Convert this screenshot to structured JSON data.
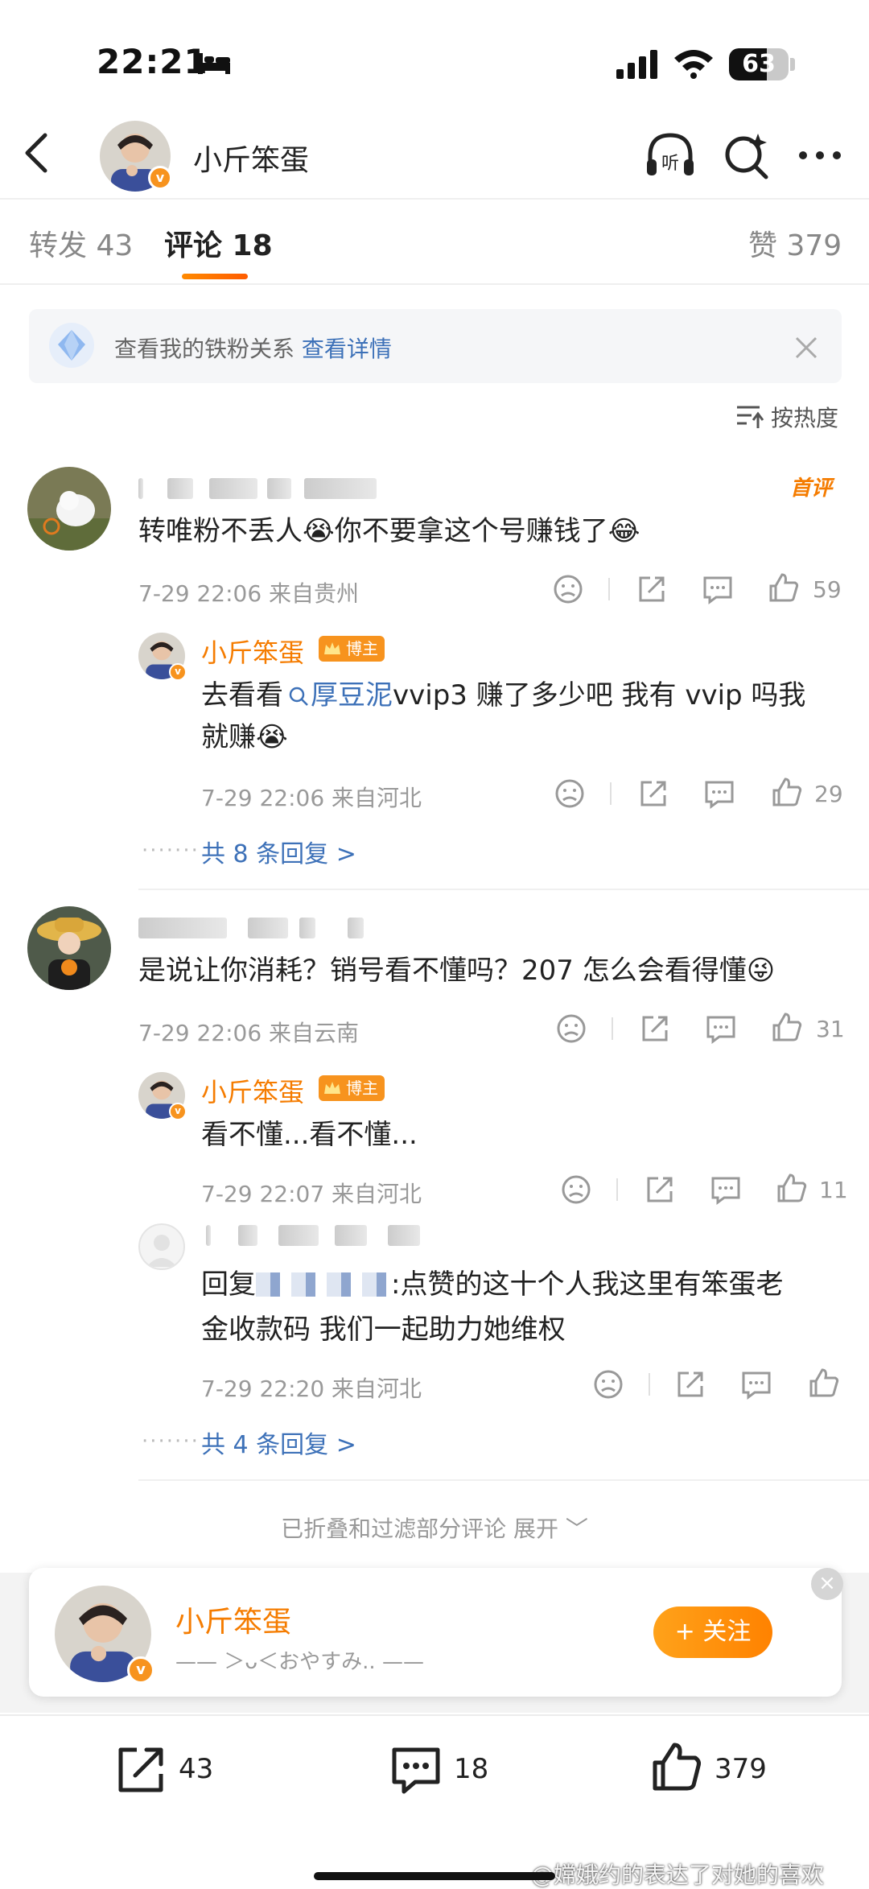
{
  "status_bar": {
    "time": "22:21",
    "battery": "63",
    "battery_level": 0.63
  },
  "nav": {
    "title": "小斤笨蛋"
  },
  "tabs": [
    {
      "label": "转发 43"
    },
    {
      "label": "评论 18"
    },
    {
      "label": "赞 379"
    }
  ],
  "fan_banner": {
    "text": "查看我的铁粉关系",
    "link": "查看详情"
  },
  "sort": {
    "label": "按热度"
  },
  "comments": [
    {
      "badge": "首评",
      "text": "转唯粉不丢人😭你不要拿这个号赚钱了😂",
      "meta": "7-29 22:06 来自贵州",
      "likes": "59",
      "reply": {
        "name": "小斤笨蛋",
        "tag": "博主",
        "text_prefix": "去看看",
        "link": "厚豆泥",
        "text_line1_rest": "vvip3 赚了多少吧 我有 vvip 吗我",
        "text_line2": "就赚😭",
        "meta": "7-29 22:06 来自河北",
        "likes": "29"
      },
      "more": "共 8 条回复 >"
    },
    {
      "text": "是说让你消耗？销号看不懂吗？207 怎么会看得懂😜",
      "meta": "7-29 22:06 来自云南",
      "likes": "31",
      "reply": {
        "name": "小斤笨蛋",
        "tag": "博主",
        "text": "看不懂...看不懂...",
        "meta": "7-29 22:07 来自河北",
        "likes": "11"
      },
      "reply2": {
        "prefix": "回复",
        "line1": ":点赞的这十个人我这里有笨蛋老",
        "line2": "金收款码 我们一起助力她维权",
        "meta": "7-29 22:20 来自河北"
      },
      "more": "共 4 条回复 >"
    }
  ],
  "folded": "已折叠和过滤部分评论 展开 ﹀",
  "follow_card": {
    "name": "小斤笨蛋",
    "subtitle": "—— ＞ᴗ＜おやすみ.. ——",
    "button": "+ 关注",
    "close": "×"
  },
  "bottom_bar": {
    "repost": "43",
    "comment": "18",
    "like": "379"
  },
  "watermark": "@嫦娥约的表达了对她的喜欢",
  "colors": {
    "accent": "#f57c00",
    "link": "#3d71b8"
  }
}
